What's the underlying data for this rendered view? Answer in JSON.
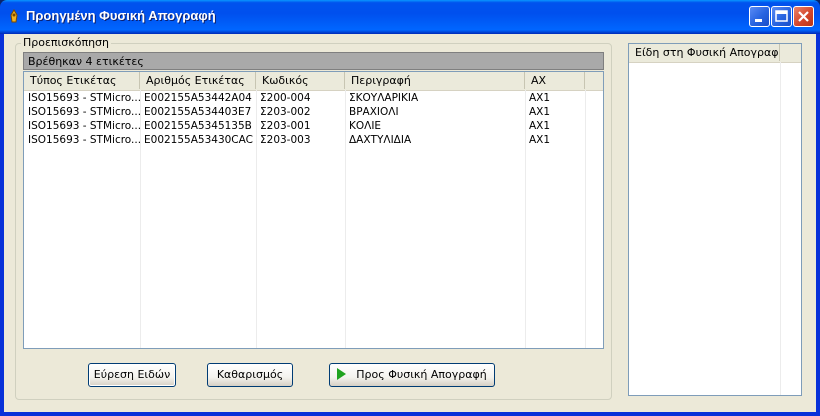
{
  "window": {
    "title": "Προηγμένη Φυσική Απογραφή",
    "controls": {
      "minimize": "minimize-icon",
      "maximize": "maximize-icon",
      "close": "close-icon"
    }
  },
  "preview_group": {
    "label": "Προεπισκόπηση",
    "status": "Βρέθηκαν 4 ετικέτες",
    "columns": [
      "Τύπος Ετικέτας",
      "Αριθμός Ετικέτας",
      "Κωδικός",
      "Περιγραφή",
      "ΑΧ"
    ],
    "rows": [
      [
        "ISO15693 - STMicro...",
        "E002155A53442A04",
        "Σ200-004",
        "ΣΚΟΥΛΑΡΙΚΙΑ",
        "ΑΧ1"
      ],
      [
        "ISO15693 - STMicro...",
        "E002155A534403E7",
        "Σ203-002",
        "ΒΡΑΧΙΟΛΙ",
        "ΑΧ1"
      ],
      [
        "ISO15693 - STMicro...",
        "E002155A5345135B",
        "Σ203-001",
        "ΚΟΛΙΕ",
        "ΑΧ1"
      ],
      [
        "ISO15693 - STMicro...",
        "E002155A53430CAC",
        "Σ203-003",
        "ΔΑΧΤΥΛΙΔΙΑ",
        "ΑΧ1"
      ]
    ]
  },
  "buttons": {
    "find": "Εύρεση Ειδών",
    "clear": "Καθαρισμός",
    "to_inventory": "Προς Φυσική Απογραφή"
  },
  "inventory_list": {
    "columns": [
      "Είδη στη Φυσική Απογραφή"
    ],
    "rows": []
  },
  "colors": {
    "titlebar": "#0054e3",
    "face": "#ece9d8",
    "status_panel": "#a9a9a9",
    "play_icon": "#1fa31f"
  }
}
